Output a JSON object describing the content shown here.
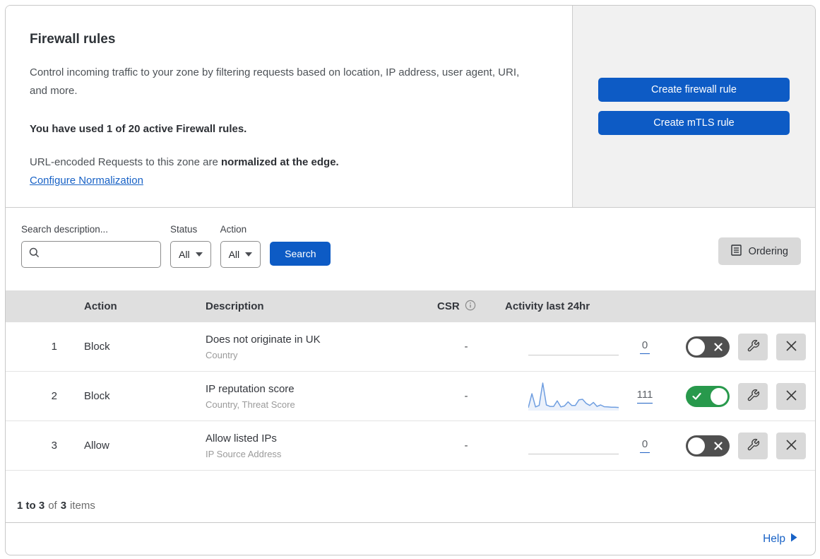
{
  "header": {
    "title": "Firewall rules",
    "description": "Control incoming traffic to your zone by filtering requests based on location, IP address, user agent, URI, and more.",
    "usage": "You have used 1 of 20 active Firewall rules.",
    "normalization_prefix": "URL-encoded Requests to this zone are ",
    "normalization_bold": "normalized at the edge.",
    "normalization_link": "Configure Normalization",
    "create_firewall_button": "Create firewall rule",
    "create_mtls_button": "Create mTLS rule"
  },
  "filters": {
    "search_label": "Search description...",
    "search_value": "",
    "search_placeholder": "",
    "status_label": "Status",
    "status_value": "All",
    "action_label": "Action",
    "action_value": "All",
    "search_button": "Search",
    "ordering_button": "Ordering"
  },
  "table": {
    "columns": {
      "action": "Action",
      "description": "Description",
      "csr": "CSR",
      "activity": "Activity last 24hr"
    },
    "rows": [
      {
        "index": "1",
        "action": "Block",
        "description": "Does not originate in UK",
        "expression": "Country",
        "csr": "-",
        "count": "0",
        "enabled": false,
        "sparkline": []
      },
      {
        "index": "2",
        "action": "Block",
        "description": "IP reputation score",
        "expression": "Country, Threat Score",
        "csr": "-",
        "count": "111",
        "enabled": true,
        "sparkline": [
          3,
          58,
          6,
          12,
          100,
          14,
          8,
          8,
          30,
          6,
          10,
          26,
          12,
          12,
          34,
          36,
          20,
          12,
          24,
          8,
          14,
          7,
          6,
          5,
          5,
          4
        ]
      },
      {
        "index": "3",
        "action": "Allow",
        "description": "Allow listed IPs",
        "expression": "IP Source Address",
        "csr": "-",
        "count": "0",
        "enabled": false,
        "sparkline": []
      }
    ]
  },
  "footer": {
    "range": "1 to 3",
    "of": "of",
    "total": "3",
    "items": "items",
    "help": "Help"
  },
  "colors": {
    "accent_blue": "#0d5bc5",
    "link_blue": "#1862c6",
    "toggle_on_green": "#28994c",
    "toggle_off_gray": "#4f4f4f",
    "panel_gray": "#f1f1f1",
    "table_header_gray": "#dfdfdf",
    "sparkline_blue": "#6f9ee0"
  }
}
